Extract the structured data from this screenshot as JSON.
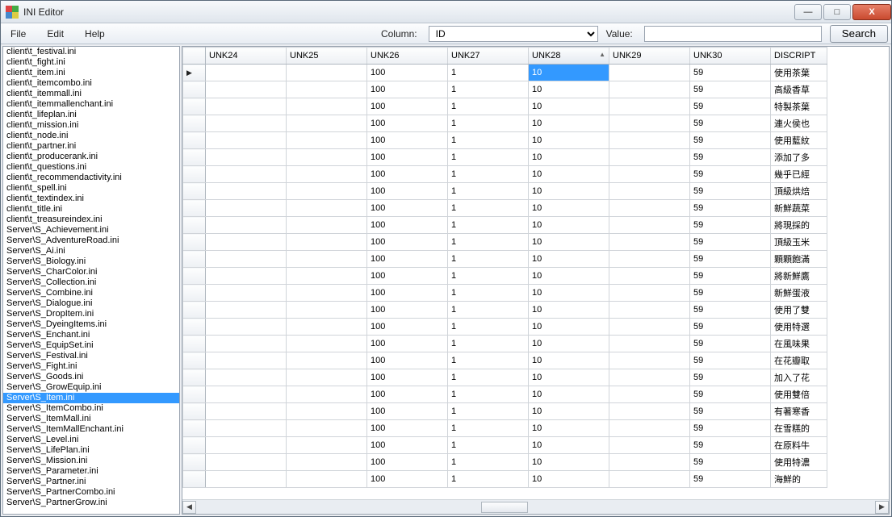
{
  "window": {
    "title": "INI Editor",
    "min": "—",
    "max": "□",
    "close": "X"
  },
  "menu": {
    "file": "File",
    "edit": "Edit",
    "help": "Help"
  },
  "search": {
    "column_label": "Column:",
    "column_value": "ID",
    "value_label": "Value:",
    "value_value": "",
    "button": "Search"
  },
  "sidebar": {
    "selected_index": 33,
    "items": [
      "client\\t_festival.ini",
      "client\\t_fight.ini",
      "client\\t_item.ini",
      "client\\t_itemcombo.ini",
      "client\\t_itemmall.ini",
      "client\\t_itemmallenchant.ini",
      "client\\t_lifeplan.ini",
      "client\\t_mission.ini",
      "client\\t_node.ini",
      "client\\t_partner.ini",
      "client\\t_producerank.ini",
      "client\\t_questions.ini",
      "client\\t_recommendactivity.ini",
      "client\\t_spell.ini",
      "client\\t_textindex.ini",
      "client\\t_title.ini",
      "client\\t_treasureindex.ini",
      "Server\\S_Achievement.ini",
      "Server\\S_AdventureRoad.ini",
      "Server\\S_Ai.ini",
      "Server\\S_Biology.ini",
      "Server\\S_CharColor.ini",
      "Server\\S_Collection.ini",
      "Server\\S_Combine.ini",
      "Server\\S_Dialogue.ini",
      "Server\\S_DropItem.ini",
      "Server\\S_DyeingItems.ini",
      "Server\\S_Enchant.ini",
      "Server\\S_EquipSet.ini",
      "Server\\S_Festival.ini",
      "Server\\S_Fight.ini",
      "Server\\S_Goods.ini",
      "Server\\S_GrowEquip.ini",
      "Server\\S_Item.ini",
      "Server\\S_ItemCombo.ini",
      "Server\\S_ItemMall.ini",
      "Server\\S_ItemMallEnchant.ini",
      "Server\\S_Level.ini",
      "Server\\S_LifePlan.ini",
      "Server\\S_Mission.ini",
      "Server\\S_Parameter.ini",
      "Server\\S_Partner.ini",
      "Server\\S_PartnerCombo.ini",
      "Server\\S_PartnerGrow.ini"
    ]
  },
  "grid": {
    "columns": [
      "UNK24",
      "UNK25",
      "UNK26",
      "UNK27",
      "UNK28",
      "UNK29",
      "UNK30",
      "DISCRIPT"
    ],
    "sorted_index": 4,
    "selected": {
      "row": 0,
      "col": 4
    },
    "rows": [
      {
        "c": [
          "",
          "",
          "100",
          "1",
          "10",
          "",
          "59",
          "使用茶葉"
        ]
      },
      {
        "c": [
          "",
          "",
          "100",
          "1",
          "10",
          "",
          "59",
          "高級香草"
        ]
      },
      {
        "c": [
          "",
          "",
          "100",
          "1",
          "10",
          "",
          "59",
          "特製茶葉"
        ]
      },
      {
        "c": [
          "",
          "",
          "100",
          "1",
          "10",
          "",
          "59",
          "連火侯也"
        ]
      },
      {
        "c": [
          "",
          "",
          "100",
          "1",
          "10",
          "",
          "59",
          "使用藍紋"
        ]
      },
      {
        "c": [
          "",
          "",
          "100",
          "1",
          "10",
          "",
          "59",
          "添加了多"
        ]
      },
      {
        "c": [
          "",
          "",
          "100",
          "1",
          "10",
          "",
          "59",
          "幾乎已經"
        ]
      },
      {
        "c": [
          "",
          "",
          "100",
          "1",
          "10",
          "",
          "59",
          "頂級烘焙"
        ]
      },
      {
        "c": [
          "",
          "",
          "100",
          "1",
          "10",
          "",
          "59",
          "新鮮蔬菜"
        ]
      },
      {
        "c": [
          "",
          "",
          "100",
          "1",
          "10",
          "",
          "59",
          "將現採的"
        ]
      },
      {
        "c": [
          "",
          "",
          "100",
          "1",
          "10",
          "",
          "59",
          "頂級玉米"
        ]
      },
      {
        "c": [
          "",
          "",
          "100",
          "1",
          "10",
          "",
          "59",
          "顆顆飽滿"
        ]
      },
      {
        "c": [
          "",
          "",
          "100",
          "1",
          "10",
          "",
          "59",
          "將新鮮鷹"
        ]
      },
      {
        "c": [
          "",
          "",
          "100",
          "1",
          "10",
          "",
          "59",
          "新鮮蛋液"
        ]
      },
      {
        "c": [
          "",
          "",
          "100",
          "1",
          "10",
          "",
          "59",
          "使用了雙"
        ]
      },
      {
        "c": [
          "",
          "",
          "100",
          "1",
          "10",
          "",
          "59",
          "使用特選"
        ]
      },
      {
        "c": [
          "",
          "",
          "100",
          "1",
          "10",
          "",
          "59",
          "在風味果"
        ]
      },
      {
        "c": [
          "",
          "",
          "100",
          "1",
          "10",
          "",
          "59",
          "在花瓣取"
        ]
      },
      {
        "c": [
          "",
          "",
          "100",
          "1",
          "10",
          "",
          "59",
          "加入了花"
        ]
      },
      {
        "c": [
          "",
          "",
          "100",
          "1",
          "10",
          "",
          "59",
          "使用雙倍"
        ]
      },
      {
        "c": [
          "",
          "",
          "100",
          "1",
          "10",
          "",
          "59",
          "有著寒香"
        ]
      },
      {
        "c": [
          "",
          "",
          "100",
          "1",
          "10",
          "",
          "59",
          "在雪糕的"
        ]
      },
      {
        "c": [
          "",
          "",
          "100",
          "1",
          "10",
          "",
          "59",
          "在原料牛"
        ]
      },
      {
        "c": [
          "",
          "",
          "100",
          "1",
          "10",
          "",
          "59",
          "使用特濃"
        ]
      },
      {
        "c": [
          "",
          "",
          "100",
          "1",
          "10",
          "",
          "59",
          "海鮮的"
        ]
      }
    ]
  }
}
